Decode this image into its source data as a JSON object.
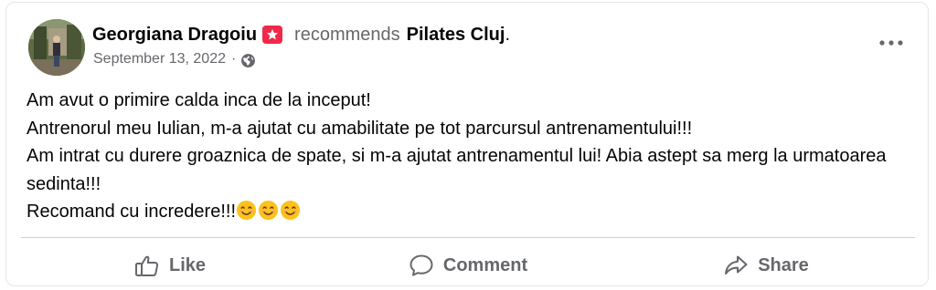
{
  "post": {
    "author_name": "Georgiana Dragoiu",
    "recommends_label": "recommends",
    "page_name": "Pilates Cluj",
    "period": ".",
    "date": "September 13, 2022",
    "date_separator": "·",
    "privacy_icon": "globe-icon",
    "badge_icon": "recommend-star-icon",
    "more_icon": "more-options-icon",
    "body_lines": [
      "Am avut o primire calda inca de la inceput!",
      "Antrenorul meu Iulian, m-a ajutat cu amabilitate pe tot parcursul antrenamentului!!!",
      "Am intrat cu durere groaznica de spate, si m-a ajutat antrenamentul lui! Abia astept sa merg la urmatoarea sedinta!!!",
      "Recomand cu incredere!!!"
    ],
    "emoji": [
      "😊",
      "😊",
      "😊"
    ]
  },
  "actions": {
    "like_label": "Like",
    "comment_label": "Comment",
    "share_label": "Share"
  },
  "colors": {
    "badge": "#f02849",
    "secondary_text": "#65676b",
    "primary_text": "#050505",
    "divider": "#ced0d4",
    "emoji_face": "#fcc21b"
  }
}
